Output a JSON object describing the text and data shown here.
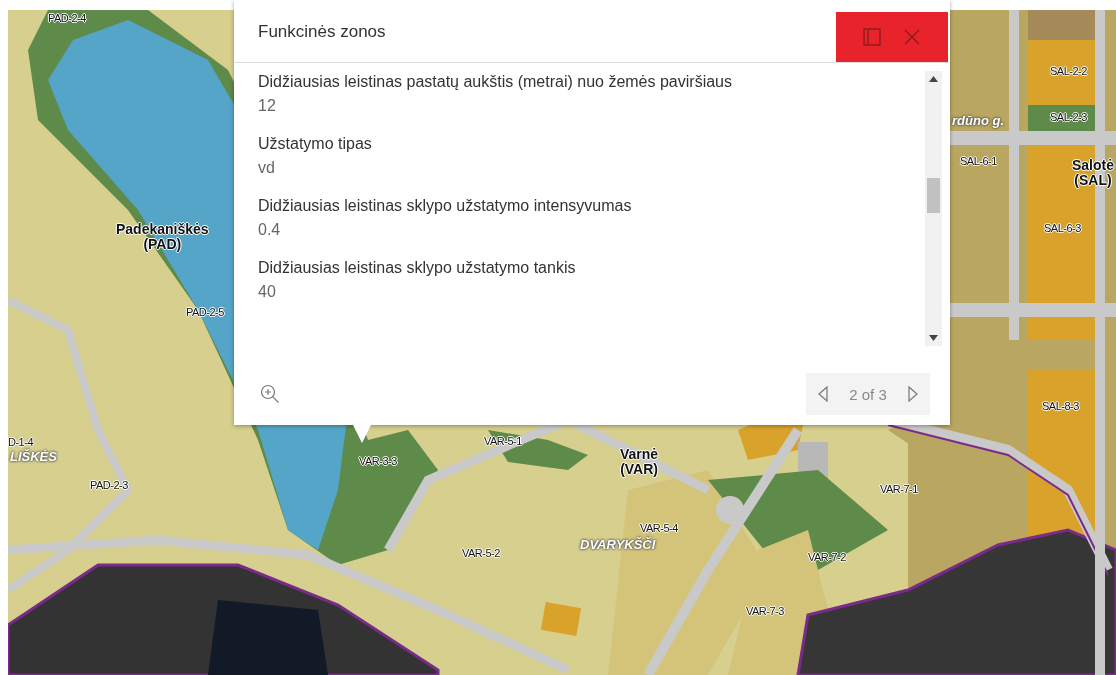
{
  "popup": {
    "title": "Funkcinės zonos",
    "fields": [
      {
        "label": "Didžiausias leistinas pastatų aukštis (metrai) nuo žemės paviršiaus",
        "value": "12"
      },
      {
        "label": "Užstatymo tipas",
        "value": "vd"
      },
      {
        "label": "Didžiausias leistinas sklypo užstatymo intensyvumas",
        "value": "0.4"
      },
      {
        "label": "Didžiausias leistinas sklypo užstatymo tankis",
        "value": "40"
      }
    ],
    "pagination": "2 of 3"
  },
  "map": {
    "labels": [
      {
        "text": "PAD-2-4",
        "kind": "zone"
      },
      {
        "text": "Padekaniškės\n(PAD)",
        "kind": "place"
      },
      {
        "text": "PAD-2-5",
        "kind": "zone"
      },
      {
        "text": "D-1-4",
        "kind": "zone"
      },
      {
        "text": "LIŠKĖS",
        "kind": "street"
      },
      {
        "text": "PAD-2-3",
        "kind": "zone"
      },
      {
        "text": "VAR-3-3",
        "kind": "zone"
      },
      {
        "text": "VAR-5-1",
        "kind": "zone"
      },
      {
        "text": "Varnė\n(VAR)",
        "kind": "place"
      },
      {
        "text": "VAR-7-1",
        "kind": "zone"
      },
      {
        "text": "VAR-5-4",
        "kind": "zone"
      },
      {
        "text": "DVARYKŠČI",
        "kind": "street"
      },
      {
        "text": "VAR-5-2",
        "kind": "zone"
      },
      {
        "text": "VAR-7-2",
        "kind": "zone"
      },
      {
        "text": "VAR-7-3",
        "kind": "zone"
      },
      {
        "text": "SAL-2-2",
        "kind": "zone"
      },
      {
        "text": "SAL-2-3",
        "kind": "zone"
      },
      {
        "text": "rdūno g.",
        "kind": "street"
      },
      {
        "text": "SAL-6-1",
        "kind": "zone"
      },
      {
        "text": "Salotė\n(SAL)",
        "kind": "place"
      },
      {
        "text": "SAL-6-3",
        "kind": "zone"
      },
      {
        "text": "SAL-8-3",
        "kind": "zone"
      }
    ]
  }
}
